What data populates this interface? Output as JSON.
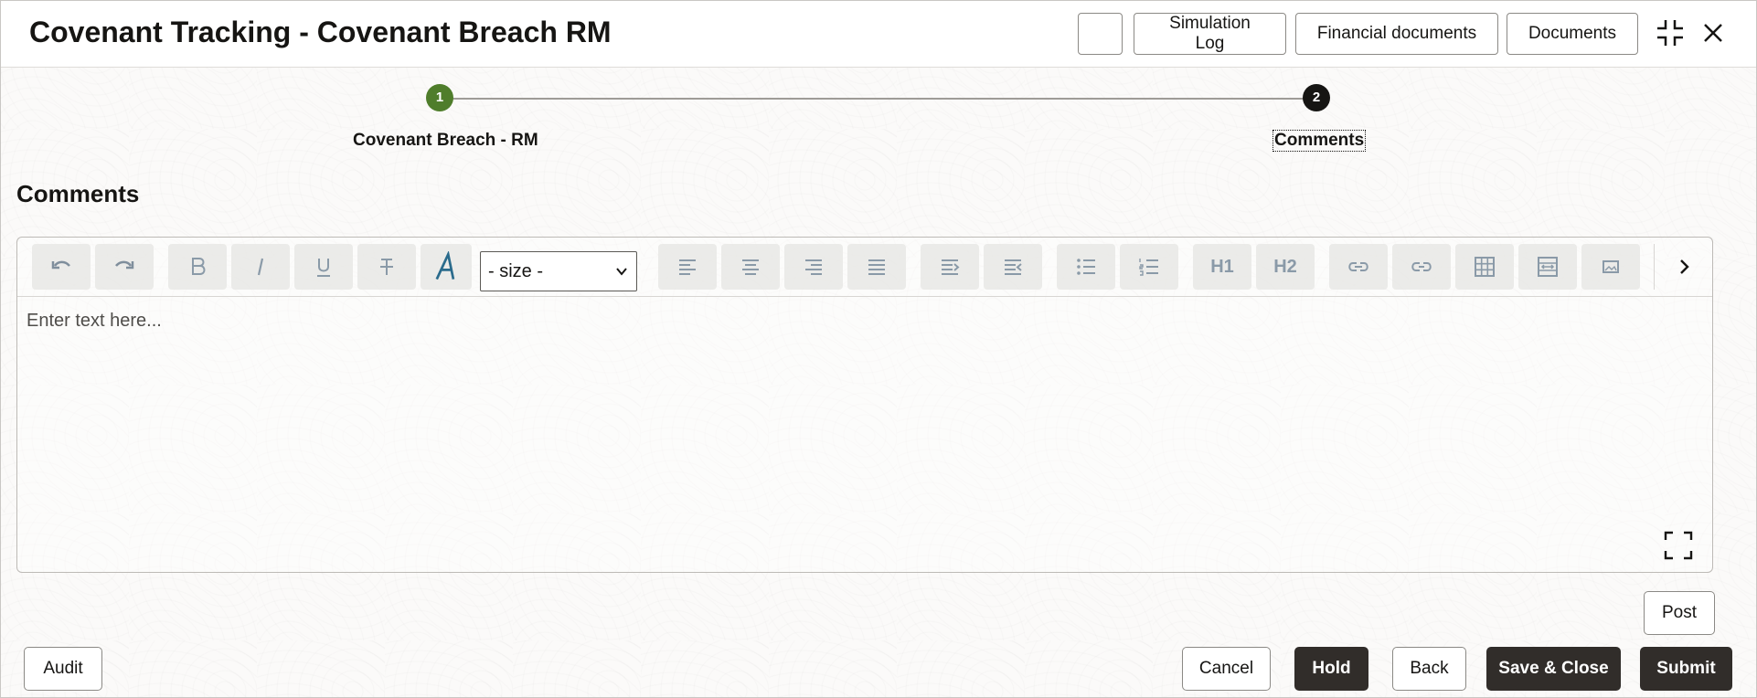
{
  "header": {
    "title": "Covenant Tracking - Covenant Breach RM",
    "buttons": {
      "simulation_log": "Simulation Log",
      "financial_documents": "Financial documents",
      "documents": "Documents"
    }
  },
  "stepper": {
    "steps": [
      {
        "number": "1",
        "label": "Covenant Breach - RM",
        "status": "completed",
        "color": "#4f7d2b"
      },
      {
        "number": "2",
        "label": "Comments",
        "status": "current",
        "color": "#161513"
      }
    ]
  },
  "section": {
    "title": "Comments"
  },
  "editor": {
    "size_select": "- size -",
    "placeholder": "Enter text here...",
    "toolbar_text": {
      "h1": "H1",
      "h2": "H2"
    }
  },
  "buttons": {
    "post": "Post",
    "audit": "Audit",
    "cancel": "Cancel",
    "hold": "Hold",
    "back": "Back",
    "save_close": "Save & Close",
    "submit": "Submit"
  }
}
